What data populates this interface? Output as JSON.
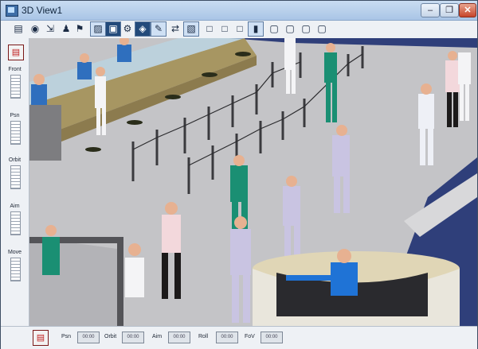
{
  "window": {
    "title": "3D View1",
    "controls": [
      {
        "name": "minimize",
        "glyph": "‒"
      },
      {
        "name": "restore",
        "glyph": "❐"
      },
      {
        "name": "close",
        "glyph": "✕"
      }
    ]
  },
  "toolbar": {
    "buttons": [
      {
        "name": "view-table-icon",
        "glyph": "▤"
      },
      {
        "name": "binoculars-icon",
        "glyph": "◉"
      },
      {
        "name": "camera-move-icon",
        "glyph": "⇲"
      },
      {
        "name": "person-icon",
        "glyph": "♟"
      },
      {
        "name": "walk-icon",
        "glyph": "⚑"
      },
      {
        "name": "select-icon",
        "glyph": "▨"
      },
      {
        "name": "render-icon",
        "glyph": "▣"
      },
      {
        "name": "robot-icon",
        "glyph": "⚙"
      },
      {
        "name": "layer-icon",
        "glyph": "◈"
      },
      {
        "name": "edit-scene-icon",
        "glyph": "✎"
      },
      {
        "name": "link-icon",
        "glyph": "⇄"
      },
      {
        "name": "node-icon",
        "glyph": "▧"
      },
      {
        "name": "box-front-icon",
        "glyph": "□"
      },
      {
        "name": "box-side-icon",
        "glyph": "□"
      },
      {
        "name": "box-top-icon",
        "glyph": "□"
      },
      {
        "name": "cylinder-icon",
        "glyph": "▮"
      },
      {
        "name": "cube-a-icon",
        "glyph": "▢"
      },
      {
        "name": "cube-b-icon",
        "glyph": "▢"
      },
      {
        "name": "cube-c-icon",
        "glyph": "▢"
      },
      {
        "name": "cube-d-icon",
        "glyph": "▢"
      }
    ]
  },
  "sidebar": {
    "labels": [
      "Front",
      "Psn",
      "Orbit",
      "Aim",
      "Move"
    ]
  },
  "bottombar": {
    "labels": [
      "Psn",
      "Orbit",
      "Aim",
      "Roll",
      "FoV"
    ]
  },
  "colors": {
    "accent": "#234a7a",
    "floor": "#c6c6c9",
    "counter": "#b8a36b"
  }
}
